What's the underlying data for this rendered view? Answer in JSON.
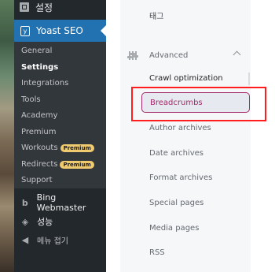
{
  "sidebar": {
    "top_item": "설정",
    "plugin": "Yoast SEO",
    "items": [
      {
        "label": "General"
      },
      {
        "label": "Settings"
      },
      {
        "label": "Integrations"
      },
      {
        "label": "Tools"
      },
      {
        "label": "Academy"
      },
      {
        "label": "Premium"
      },
      {
        "label": "Workouts",
        "badge": "Premium"
      },
      {
        "label": "Redirects",
        "badge": "Premium"
      },
      {
        "label": "Support"
      }
    ],
    "bottom": [
      {
        "label": "Bing Webmaster",
        "icon": "bing-icon"
      },
      {
        "label": "성능",
        "icon": "performance-icon"
      },
      {
        "label": "메뉴 접기",
        "icon": "collapse-menu-icon"
      }
    ]
  },
  "settings_nav": {
    "tag_link": "태그",
    "advanced": {
      "label": "Advanced",
      "icon": "sliders-icon",
      "links": [
        "Crawl optimization",
        "Breadcrumbs",
        "Author archives",
        "Date archives",
        "Format archives",
        "Special pages",
        "Media pages",
        "RSS"
      ],
      "active": "Breadcrumbs"
    }
  },
  "colors": {
    "admin_bar": "#23282d",
    "active_menu": "#2271b1",
    "yoast_accent": "#a4286a",
    "annotation": "#ff1d1d",
    "premium_badge": "#f0ca6e"
  }
}
